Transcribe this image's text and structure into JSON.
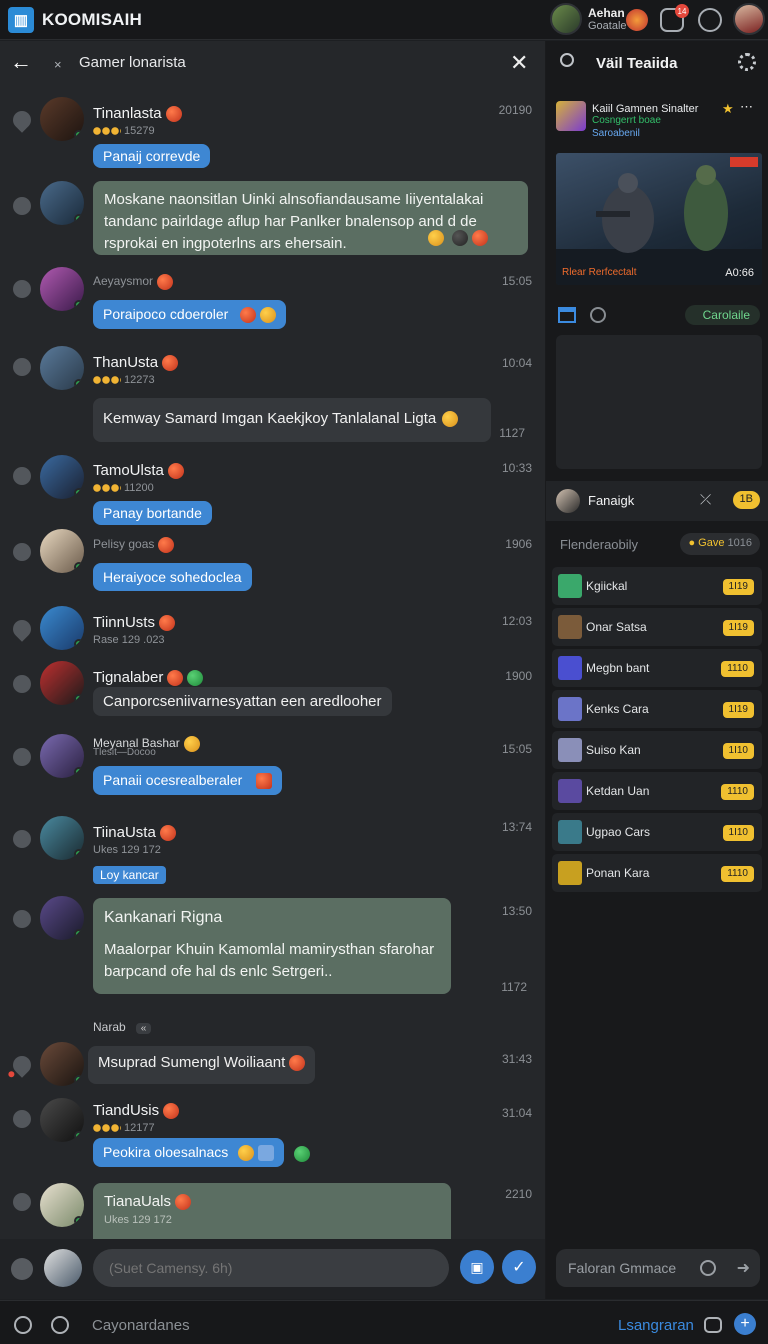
{
  "app": {
    "title": "KOOMISAIH",
    "logo_glyph": "▥"
  },
  "user": {
    "name": "Aehan",
    "status": "Goatale",
    "notifications": "14"
  },
  "chat": {
    "title": "Gamer lonarista",
    "input_placeholder": "(Suet Camensy. 6h)",
    "messages": [
      {
        "name": "Tinanlasta",
        "meta": "15279",
        "time": "20190",
        "text": "Panaij correvde",
        "kind": "blue"
      },
      {
        "text": "Moskane naonsitlan Uinki alnsofiandausame Iiiyentalakai tandanc pairldage aflup har Panlker bnalensop and d de rsprokai en ingpoterlns ars ehersain.",
        "kind": "green"
      },
      {
        "name": "Aeyaysmor",
        "time": "15:05",
        "text": "Poraipoco cdoeroler",
        "kind": "blue"
      },
      {
        "name": "ThanUsta",
        "meta": "12273",
        "time": "10:04",
        "text": "Kemway Samard Imgan Kaekjkoy Tanlalanal Ligta",
        "time2": "1127",
        "kind": "gray"
      },
      {
        "name": "TamoUlsta",
        "meta": "11200",
        "time": "10:33",
        "text": "Panay bortande",
        "kind": "blue"
      },
      {
        "name": "Pelisy goas",
        "time": "1906",
        "text": "Heraiyoce sohedoclea",
        "kind": "blue"
      },
      {
        "name": "TiinnUsts",
        "meta": "Rase 129 .023",
        "time": "12:03",
        "kind": "none"
      },
      {
        "name": "Tignalaber",
        "time": "1900",
        "text": "Canporcseniivarnesyattan een aredlooher",
        "kind": "gray"
      },
      {
        "name": "Meyanal Bashar",
        "meta": "Tlesit—Docoo",
        "time": "15:05",
        "text": "Panaii ocesrealberaler",
        "kind": "blue"
      },
      {
        "name": "TiinaUsta",
        "meta": "Ukes 129 172",
        "time": "13:74",
        "text": "Loy kancar",
        "kind": "blue"
      },
      {
        "name": "Kankanari Rigna",
        "time": "13:50",
        "text": "Maalorpar Khuin Kamomlal mamirysthan sfarohar barpcand ofe hal ds enlc Setrgeri..",
        "time2": "1172",
        "kind": "green"
      },
      {
        "name": "Narab",
        "kind": "none"
      },
      {
        "time": "31:43",
        "text": "Msuprad Sumengl Woiliaant",
        "kind": "gray"
      },
      {
        "name": "TiandUsis",
        "meta": "12177",
        "time": "31:04",
        "text": "Peokira oloesalnacs",
        "kind": "blue"
      },
      {
        "name": "TianaUals",
        "meta": "Ukes 129 172",
        "time": "2210",
        "kind": "green"
      }
    ]
  },
  "panel": {
    "title": "Väil Teaiida",
    "stream": {
      "title": "Kaiil Gamnen Sinalter",
      "subtitle": "Cosngerrt boae",
      "author": "Saroabenil",
      "caption": "Rlear Rerfcectalt",
      "timer": "A0:66"
    },
    "category_label": "Carolaile",
    "current_user": {
      "name": "Fanaigk",
      "badge": "1B"
    },
    "leaderboard": {
      "header": "Flenderaobily",
      "badge_label": "Gave",
      "badge_value": "1016",
      "rows": [
        {
          "name": "Kgiickal",
          "points": "1I19",
          "color": "#3aa86b"
        },
        {
          "name": "Onar Satsa",
          "points": "1I19",
          "color": "#7b5b3a"
        },
        {
          "name": "Megbn bant",
          "points": "1110",
          "color": "#4a4fd0"
        },
        {
          "name": "Kenks Cara",
          "points": "1I19",
          "color": "#6b74c8"
        },
        {
          "name": "Suiso Kan",
          "points": "1I10",
          "color": "#8a8fb8"
        },
        {
          "name": "Ketdan Uan",
          "points": "1110",
          "color": "#5a4aa0"
        },
        {
          "name": "Ugpao Cars",
          "points": "1I10",
          "color": "#3a7a8a"
        },
        {
          "name": "Ponan Kara",
          "points": "1110",
          "color": "#c8a020"
        }
      ]
    },
    "compose_placeholder": "Faloran Gmmace"
  },
  "bottom": {
    "text": "Cayonardanes",
    "language": "Lsangraran"
  },
  "colors": {
    "accent": "#3b7fd0",
    "badge": "#f0c030",
    "online": "#2ea44f"
  }
}
